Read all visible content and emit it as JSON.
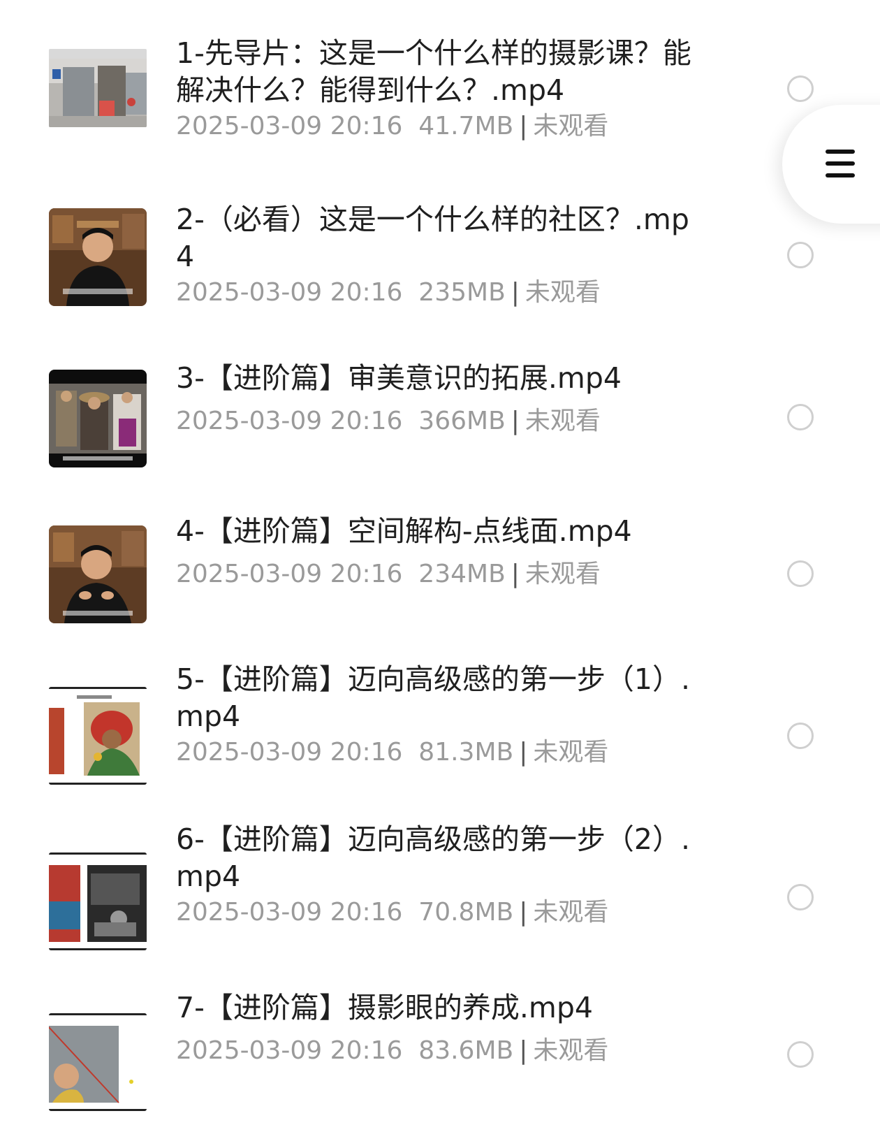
{
  "files": [
    {
      "title": "1-先导片：这是一个什么样的摄影课？能解决什么？能得到什么？.mp4",
      "date": "2025-03-09 20:16",
      "size": "41.7MB",
      "status": "未观看",
      "thumb_icon": "street-scene-thumbnail"
    },
    {
      "title": "2-（必看）这是一个什么样的社区？.mp4",
      "date": "2025-03-09 20:16",
      "size": "235MB",
      "status": "未观看",
      "thumb_icon": "presenter-thumbnail"
    },
    {
      "title": "3-【进阶篇】审美意识的拓展.mp4",
      "date": "2025-03-09 20:16",
      "size": "366MB",
      "status": "未观看",
      "thumb_icon": "crowd-photo-thumbnail"
    },
    {
      "title": "4-【进阶篇】空间解构-点线面.mp4",
      "date": "2025-03-09 20:16",
      "size": "234MB",
      "status": "未观看",
      "thumb_icon": "presenter-thumbnail"
    },
    {
      "title": "5-【进阶篇】迈向高级感的第一步（1）.mp4",
      "date": "2025-03-09 20:16",
      "size": "81.3MB",
      "status": "未观看",
      "thumb_icon": "portrait-slide-thumbnail"
    },
    {
      "title": "6-【进阶篇】迈向高级感的第一步（2）.mp4",
      "date": "2025-03-09 20:16",
      "size": "70.8MB",
      "status": "未观看",
      "thumb_icon": "photo-slide-thumbnail"
    },
    {
      "title": "7-【进阶篇】摄影眼的养成.mp4",
      "date": "2025-03-09 20:16",
      "size": "83.6MB",
      "status": "未观看",
      "thumb_icon": "portrait-slide-thumbnail"
    }
  ],
  "menu_button": {
    "icon": "hamburger-menu-icon"
  },
  "colors": {
    "title": "#1f1f1f",
    "meta": "#9a9a9a",
    "radio_border": "#cfcfcf",
    "background": "#ffffff"
  }
}
